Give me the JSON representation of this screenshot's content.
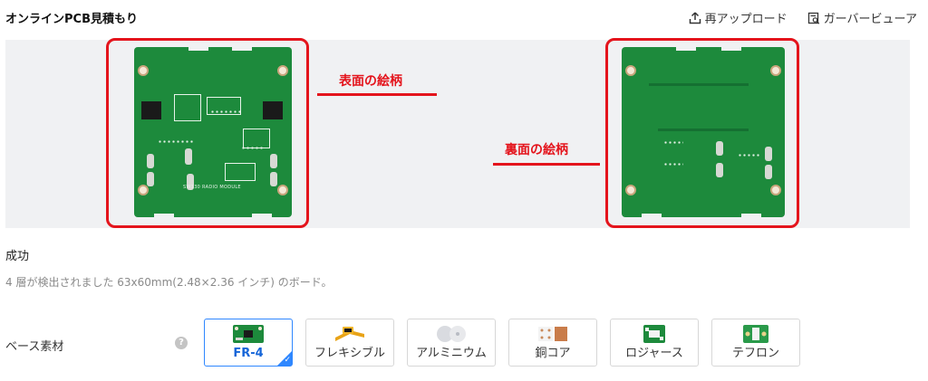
{
  "header": {
    "title": "オンラインPCB見積もり",
    "reupload_label": "再アップロード",
    "gerber_viewer_label": "ガーバービューア"
  },
  "annotations": {
    "front_label": "表面の絵柄",
    "back_label": "裏面の絵柄"
  },
  "board": {
    "front_text": "SW130 RADIO MODULE"
  },
  "status": {
    "title": "成功",
    "detail": "4 層が検出されました 63x60mm(2.48×2.36 インチ) のボード。"
  },
  "base_material": {
    "label": "ベース素材",
    "help": "?",
    "check": "✓",
    "options": [
      {
        "label": "FR-4",
        "selected": true
      },
      {
        "label": "フレキシブル",
        "selected": false
      },
      {
        "label": "アルミニウム",
        "selected": false
      },
      {
        "label": "銅コア",
        "selected": false
      },
      {
        "label": "ロジャース",
        "selected": false
      },
      {
        "label": "テフロン",
        "selected": false
      }
    ]
  },
  "colors": {
    "pcb_green": "#1d8a3c",
    "annotation_red": "#e4141c",
    "selected_blue": "#2f87ff"
  }
}
